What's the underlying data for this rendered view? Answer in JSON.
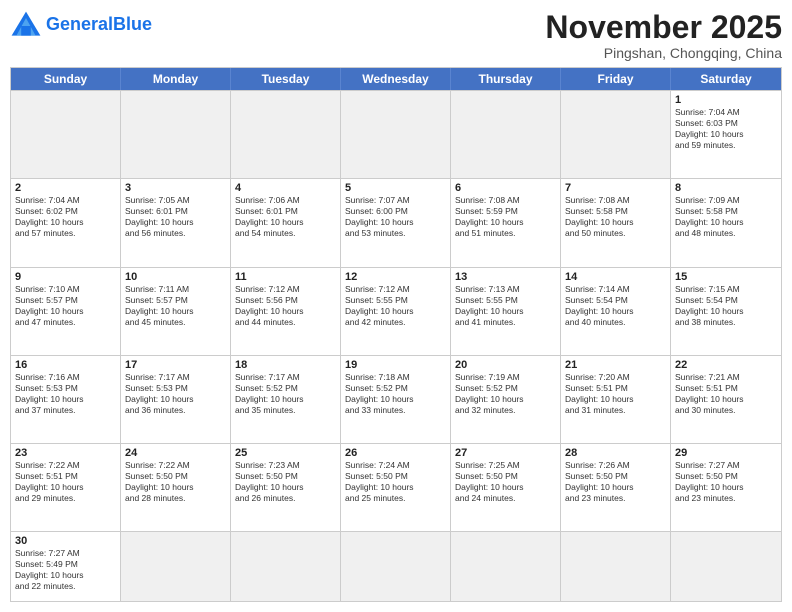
{
  "header": {
    "logo_general": "General",
    "logo_blue": "Blue",
    "month_title": "November 2025",
    "location": "Pingshan, Chongqing, China"
  },
  "days_of_week": [
    "Sunday",
    "Monday",
    "Tuesday",
    "Wednesday",
    "Thursday",
    "Friday",
    "Saturday"
  ],
  "rows": [
    [
      {
        "day": "",
        "info": ""
      },
      {
        "day": "",
        "info": ""
      },
      {
        "day": "",
        "info": ""
      },
      {
        "day": "",
        "info": ""
      },
      {
        "day": "",
        "info": ""
      },
      {
        "day": "",
        "info": ""
      },
      {
        "day": "1",
        "info": "Sunrise: 7:04 AM\nSunset: 6:03 PM\nDaylight: 10 hours\nand 59 minutes."
      }
    ],
    [
      {
        "day": "2",
        "info": "Sunrise: 7:04 AM\nSunset: 6:02 PM\nDaylight: 10 hours\nand 57 minutes."
      },
      {
        "day": "3",
        "info": "Sunrise: 7:05 AM\nSunset: 6:01 PM\nDaylight: 10 hours\nand 56 minutes."
      },
      {
        "day": "4",
        "info": "Sunrise: 7:06 AM\nSunset: 6:01 PM\nDaylight: 10 hours\nand 54 minutes."
      },
      {
        "day": "5",
        "info": "Sunrise: 7:07 AM\nSunset: 6:00 PM\nDaylight: 10 hours\nand 53 minutes."
      },
      {
        "day": "6",
        "info": "Sunrise: 7:08 AM\nSunset: 5:59 PM\nDaylight: 10 hours\nand 51 minutes."
      },
      {
        "day": "7",
        "info": "Sunrise: 7:08 AM\nSunset: 5:58 PM\nDaylight: 10 hours\nand 50 minutes."
      },
      {
        "day": "8",
        "info": "Sunrise: 7:09 AM\nSunset: 5:58 PM\nDaylight: 10 hours\nand 48 minutes."
      }
    ],
    [
      {
        "day": "9",
        "info": "Sunrise: 7:10 AM\nSunset: 5:57 PM\nDaylight: 10 hours\nand 47 minutes."
      },
      {
        "day": "10",
        "info": "Sunrise: 7:11 AM\nSunset: 5:57 PM\nDaylight: 10 hours\nand 45 minutes."
      },
      {
        "day": "11",
        "info": "Sunrise: 7:12 AM\nSunset: 5:56 PM\nDaylight: 10 hours\nand 44 minutes."
      },
      {
        "day": "12",
        "info": "Sunrise: 7:12 AM\nSunset: 5:55 PM\nDaylight: 10 hours\nand 42 minutes."
      },
      {
        "day": "13",
        "info": "Sunrise: 7:13 AM\nSunset: 5:55 PM\nDaylight: 10 hours\nand 41 minutes."
      },
      {
        "day": "14",
        "info": "Sunrise: 7:14 AM\nSunset: 5:54 PM\nDaylight: 10 hours\nand 40 minutes."
      },
      {
        "day": "15",
        "info": "Sunrise: 7:15 AM\nSunset: 5:54 PM\nDaylight: 10 hours\nand 38 minutes."
      }
    ],
    [
      {
        "day": "16",
        "info": "Sunrise: 7:16 AM\nSunset: 5:53 PM\nDaylight: 10 hours\nand 37 minutes."
      },
      {
        "day": "17",
        "info": "Sunrise: 7:17 AM\nSunset: 5:53 PM\nDaylight: 10 hours\nand 36 minutes."
      },
      {
        "day": "18",
        "info": "Sunrise: 7:17 AM\nSunset: 5:52 PM\nDaylight: 10 hours\nand 35 minutes."
      },
      {
        "day": "19",
        "info": "Sunrise: 7:18 AM\nSunset: 5:52 PM\nDaylight: 10 hours\nand 33 minutes."
      },
      {
        "day": "20",
        "info": "Sunrise: 7:19 AM\nSunset: 5:52 PM\nDaylight: 10 hours\nand 32 minutes."
      },
      {
        "day": "21",
        "info": "Sunrise: 7:20 AM\nSunset: 5:51 PM\nDaylight: 10 hours\nand 31 minutes."
      },
      {
        "day": "22",
        "info": "Sunrise: 7:21 AM\nSunset: 5:51 PM\nDaylight: 10 hours\nand 30 minutes."
      }
    ],
    [
      {
        "day": "23",
        "info": "Sunrise: 7:22 AM\nSunset: 5:51 PM\nDaylight: 10 hours\nand 29 minutes."
      },
      {
        "day": "24",
        "info": "Sunrise: 7:22 AM\nSunset: 5:50 PM\nDaylight: 10 hours\nand 28 minutes."
      },
      {
        "day": "25",
        "info": "Sunrise: 7:23 AM\nSunset: 5:50 PM\nDaylight: 10 hours\nand 26 minutes."
      },
      {
        "day": "26",
        "info": "Sunrise: 7:24 AM\nSunset: 5:50 PM\nDaylight: 10 hours\nand 25 minutes."
      },
      {
        "day": "27",
        "info": "Sunrise: 7:25 AM\nSunset: 5:50 PM\nDaylight: 10 hours\nand 24 minutes."
      },
      {
        "day": "28",
        "info": "Sunrise: 7:26 AM\nSunset: 5:50 PM\nDaylight: 10 hours\nand 23 minutes."
      },
      {
        "day": "29",
        "info": "Sunrise: 7:27 AM\nSunset: 5:50 PM\nDaylight: 10 hours\nand 23 minutes."
      }
    ],
    [
      {
        "day": "30",
        "info": "Sunrise: 7:27 AM\nSunset: 5:49 PM\nDaylight: 10 hours\nand 22 minutes."
      },
      {
        "day": "",
        "info": ""
      },
      {
        "day": "",
        "info": ""
      },
      {
        "day": "",
        "info": ""
      },
      {
        "day": "",
        "info": ""
      },
      {
        "day": "",
        "info": ""
      },
      {
        "day": "",
        "info": ""
      }
    ]
  ]
}
